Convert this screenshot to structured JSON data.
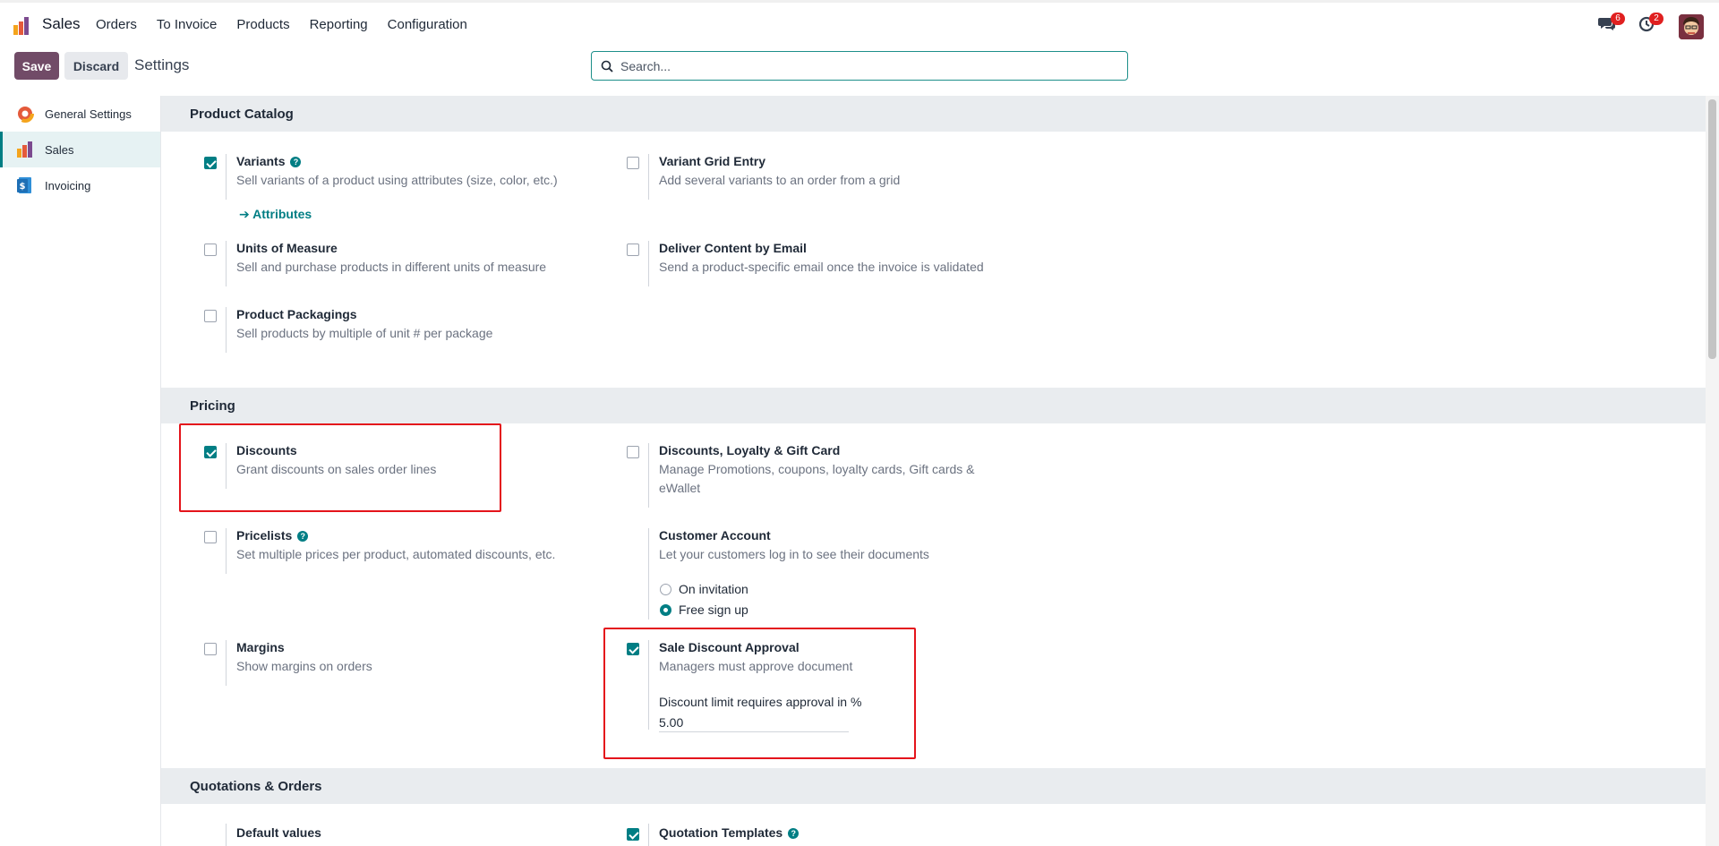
{
  "navbar": {
    "app_name": "Sales",
    "menu": [
      "Orders",
      "To Invoice",
      "Products",
      "Reporting",
      "Configuration"
    ],
    "messages_badge": "6",
    "activities_badge": "2"
  },
  "control_panel": {
    "save_label": "Save",
    "discard_label": "Discard",
    "title": "Settings",
    "search_placeholder": "Search..."
  },
  "sidebar": {
    "items": [
      {
        "label": "General Settings",
        "icon": "general-settings-icon"
      },
      {
        "label": "Sales",
        "icon": "sales-app-icon",
        "active": true
      },
      {
        "label": "Invoicing",
        "icon": "invoicing-app-icon"
      }
    ]
  },
  "sections": {
    "product_catalog": {
      "title": "Product Catalog",
      "variants": {
        "title": "Variants",
        "desc": "Sell variants of a product using attributes (size, color, etc.)",
        "checked": true,
        "link": "Attributes"
      },
      "variant_grid": {
        "title": "Variant Grid Entry",
        "desc": "Add several variants to an order from a grid",
        "checked": false
      },
      "uom": {
        "title": "Units of Measure",
        "desc": "Sell and purchase products in different units of measure",
        "checked": false
      },
      "deliver_email": {
        "title": "Deliver Content by Email",
        "desc": "Send a product-specific email once the invoice is validated",
        "checked": false
      },
      "packagings": {
        "title": "Product Packagings",
        "desc": "Sell products by multiple of unit # per package",
        "checked": false
      }
    },
    "pricing": {
      "title": "Pricing",
      "discounts": {
        "title": "Discounts",
        "desc": "Grant discounts on sales order lines",
        "checked": true
      },
      "loyalty": {
        "title": "Discounts, Loyalty & Gift Card",
        "desc": "Manage Promotions, coupons, loyalty cards, Gift cards & eWallet",
        "checked": false
      },
      "pricelists": {
        "title": "Pricelists",
        "desc": "Set multiple prices per product, automated discounts, etc.",
        "checked": false
      },
      "customer_account": {
        "title": "Customer Account",
        "desc": "Let your customers log in to see their documents",
        "option_1": "On invitation",
        "option_2": "Free sign up",
        "selected": "Free sign up"
      },
      "margins": {
        "title": "Margins",
        "desc": "Show margins on orders",
        "checked": false
      },
      "sale_discount_approval": {
        "title": "Sale Discount Approval",
        "desc": "Managers must approve document",
        "checked": true,
        "field_label": "Discount limit requires approval in %",
        "field_value": "5.00"
      }
    },
    "quotations": {
      "title": "Quotations & Orders",
      "default_values": {
        "title": "Default values"
      },
      "quotation_templates": {
        "title": "Quotation Templates",
        "checked": true
      }
    }
  },
  "colors": {
    "brand": "#714b67",
    "accent": "#017e84",
    "highlight": "#e4141b",
    "section_bg": "#e9ecef"
  }
}
